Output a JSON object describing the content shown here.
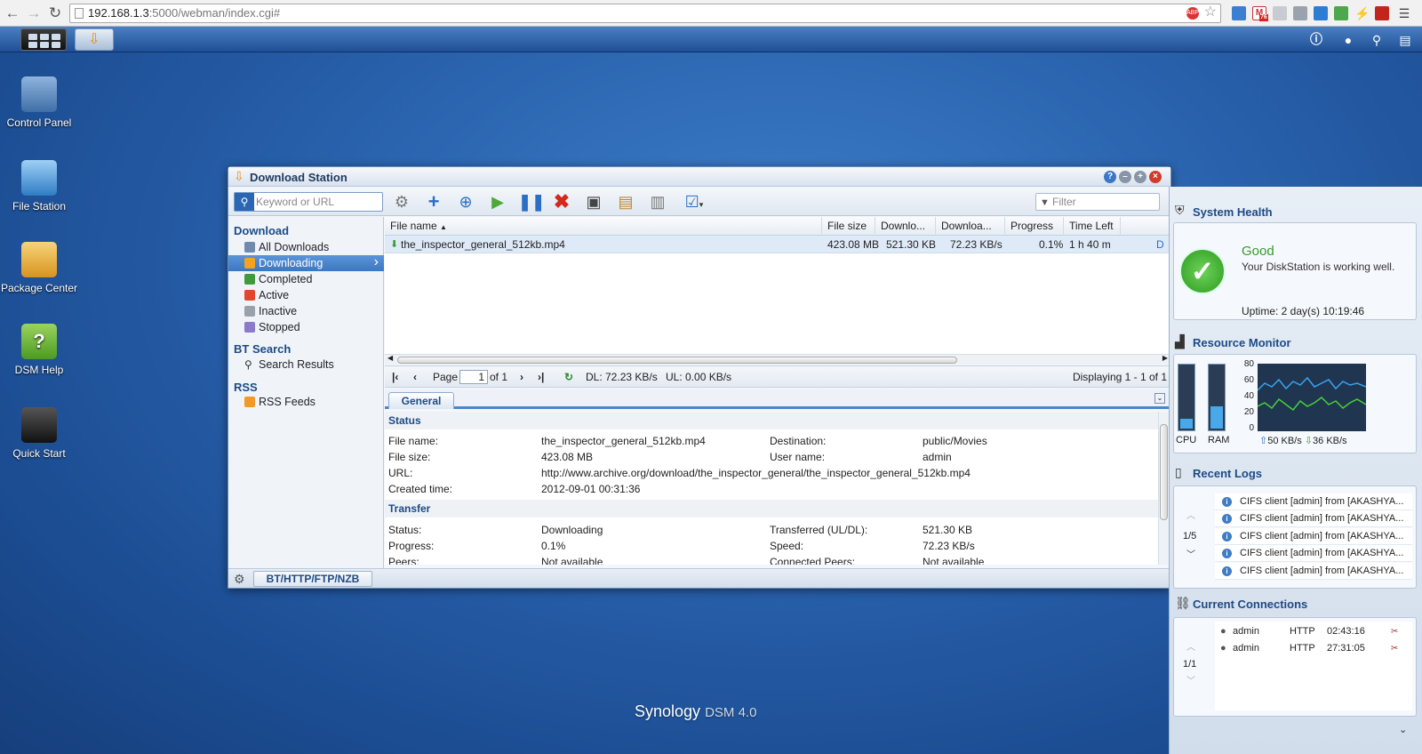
{
  "browser": {
    "url_host": "192.168.1.3",
    "url_rest": ":5000/webman/index.cgi#",
    "gmail_badge": "76"
  },
  "desktop_icons": [
    {
      "label": "Control Panel",
      "icon": "control-panel-icon",
      "color": "#5a86b8"
    },
    {
      "label": "File Station",
      "icon": "file-station-icon",
      "color": "#3e8fd0"
    },
    {
      "label": "Package Center",
      "icon": "package-center-icon",
      "color": "#e6a52a"
    },
    {
      "label": "DSM Help",
      "icon": "help-icon",
      "color": "#6bb13a"
    },
    {
      "label": "Quick Start",
      "icon": "quick-start-icon",
      "color": "#333333"
    }
  ],
  "window": {
    "title": "Download Station",
    "search_placeholder": "Keyword or URL",
    "filter_placeholder": "Filter",
    "nav": {
      "download_header": "Download",
      "items": [
        "All Downloads",
        "Downloading",
        "Completed",
        "Active",
        "Inactive",
        "Stopped"
      ],
      "bt_header": "BT Search",
      "search_results": "Search Results",
      "rss_header": "RSS",
      "rss_feeds": "RSS Feeds"
    },
    "grid": {
      "columns": [
        "File name",
        "File size",
        "Downlo...",
        "Downloa...",
        "Progress",
        "Time Left"
      ],
      "row": {
        "file": "the_inspector_general_512kb.mp4",
        "size": "423.08 MB",
        "downloaded": "521.30 KB",
        "speed": "72.23 KB/s",
        "progress": "0.1%",
        "time_left": "1 h 40 m",
        "extra": "D"
      }
    },
    "pager": {
      "page_label": "Page",
      "page_value": "1",
      "of_label": "of 1",
      "dl": "DL: 72.23 KB/s",
      "ul": "UL: 0.00 KB/s",
      "displaying": "Displaying 1 - 1 of 1"
    },
    "tab": "General",
    "status": {
      "header": "Status",
      "file_name_label": "File name:",
      "file_name": "the_inspector_general_512kb.mp4",
      "destination_label": "Destination:",
      "destination": "public/Movies",
      "file_size_label": "File size:",
      "file_size": "423.08 MB",
      "user_label": "User name:",
      "user": "admin",
      "url_label": "URL:",
      "url": "http://www.archive.org/download/the_inspector_general/the_inspector_general_512kb.mp4",
      "created_label": "Created time:",
      "created": "2012-09-01 00:31:36"
    },
    "transfer": {
      "header": "Transfer",
      "status_label": "Status:",
      "status": "Downloading",
      "transferred_label": "Transferred (UL/DL):",
      "transferred": "521.30 KB",
      "progress_label": "Progress:",
      "progress": "0.1%",
      "speed_label": "Speed:",
      "speed": "72.23 KB/s",
      "peers_label": "Peers:",
      "peers": "Not available",
      "connected_label": "Connected Peers:",
      "connected": "Not available"
    },
    "bottom_tab": "BT/HTTP/FTP/NZB"
  },
  "widgets": {
    "health": {
      "title": "System Health",
      "status": "Good",
      "message": "Your DiskStation is working well.",
      "uptime": "Uptime: 2 day(s) 10:19:46"
    },
    "resource": {
      "title": "Resource Monitor",
      "cpu": "CPU",
      "ram": "RAM",
      "y_ticks": [
        "80",
        "60",
        "40",
        "20",
        "0"
      ],
      "up": "50 KB/s",
      "down": "36 KB/s",
      "cpu_level": 0.15,
      "ram_level": 0.35
    },
    "logs": {
      "title": "Recent Logs",
      "page": "1/5",
      "entries": [
        "CIFS client [admin] from [AKASHYA...",
        "CIFS client [admin] from [AKASHYA...",
        "CIFS client [admin] from [AKASHYA...",
        "CIFS client [admin] from [AKASHYA...",
        "CIFS client [admin] from [AKASHYA..."
      ]
    },
    "connections": {
      "title": "Current Connections",
      "page": "1/1",
      "rows": [
        {
          "user": "admin",
          "type": "HTTP",
          "time": "02:43:16"
        },
        {
          "user": "admin",
          "type": "HTTP",
          "time": "27:31:05"
        }
      ]
    }
  },
  "footer": {
    "brand": "Synology",
    "product": "DSM 4.0"
  }
}
